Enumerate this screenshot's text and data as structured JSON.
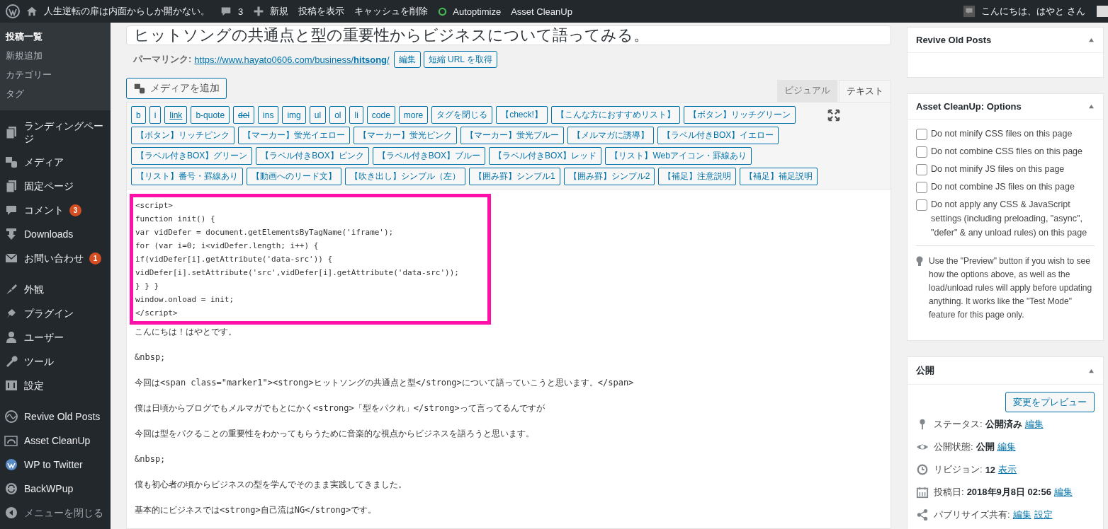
{
  "admin_bar": {
    "site_name": "人生逆転の扉は内面からしか開かない。",
    "comments": "3",
    "items": [
      "新規",
      "投稿を表示",
      "キャッシュを削除",
      "Autoptimize",
      "Asset CleanUp"
    ],
    "greeting": "こんにちは、はやと さん"
  },
  "sidebar": {
    "submenu": [
      {
        "label": "投稿一覧",
        "selected": true
      },
      {
        "label": "新規追加",
        "selected": false
      },
      {
        "label": "カテゴリー",
        "selected": false
      },
      {
        "label": "タグ",
        "selected": false
      }
    ],
    "menu": [
      {
        "label": "ランディングページ"
      },
      {
        "label": "メディア"
      },
      {
        "label": "固定ページ"
      },
      {
        "label": "コメント",
        "badge": "3"
      },
      {
        "label": "Downloads"
      },
      {
        "label": "お問い合わせ",
        "badge": "1"
      },
      {
        "label": "外観"
      },
      {
        "label": "プラグイン"
      },
      {
        "label": "ユーザー"
      },
      {
        "label": "ツール"
      },
      {
        "label": "設定"
      },
      {
        "label": "Revive Old Posts"
      },
      {
        "label": "Asset CleanUp"
      },
      {
        "label": "WP to Twitter"
      },
      {
        "label": "BackWPup"
      },
      {
        "label": "メニューを閉じる"
      }
    ]
  },
  "editor": {
    "title": "ヒットソングの共通点と型の重要性からビジネスについて語ってみる。",
    "permalink_label": "パーマリンク:",
    "permalink_base": "https://www.hayato0606.com/business/",
    "permalink_slug": "hitsong",
    "permalink_suffix": "/",
    "permalink_buttons": [
      "編集",
      "短縮 URL を取得"
    ],
    "media_button": "メディアを追加",
    "tabs": [
      {
        "label": "ビジュアル",
        "selected": false
      },
      {
        "label": "テキスト",
        "selected": true
      }
    ],
    "toolbar_rows": [
      [
        {
          "label": "b",
          "kind": "plain"
        },
        {
          "label": "i",
          "kind": "plain"
        },
        {
          "label": "link",
          "kind": "link"
        },
        {
          "label": "b-quote",
          "kind": "plain"
        },
        {
          "label": "del",
          "kind": "del"
        },
        {
          "label": "ins",
          "kind": "plain"
        },
        {
          "label": "img",
          "kind": "plain"
        },
        {
          "label": "ul",
          "kind": "plain"
        },
        {
          "label": "ol",
          "kind": "plain"
        },
        {
          "label": "li",
          "kind": "plain"
        },
        {
          "label": "code",
          "kind": "plain"
        },
        {
          "label": "more",
          "kind": "plain"
        },
        {
          "label": "タグを閉じる",
          "kind": "plain"
        },
        {
          "label": "【check!】",
          "kind": "plain"
        },
        {
          "label": "【こんな方におすすめリスト】",
          "kind": "plain"
        },
        {
          "label": "【ボタン】リッチグリーン",
          "kind": "plain"
        }
      ],
      [
        {
          "label": "【ボタン】リッチピンク",
          "kind": "plain"
        },
        {
          "label": "【マーカー】蛍光イエロー",
          "kind": "plain"
        },
        {
          "label": "【マーカー】蛍光ピンク",
          "kind": "plain"
        },
        {
          "label": "【マーカー】蛍光ブルー",
          "kind": "plain"
        },
        {
          "label": "【メルマガに誘導】",
          "kind": "plain"
        },
        {
          "label": "【ラベル付きBOX】イエロー",
          "kind": "plain"
        }
      ],
      [
        {
          "label": "【ラベル付きBOX】グリーン",
          "kind": "plain"
        },
        {
          "label": "【ラベル付きBOX】ピンク",
          "kind": "plain"
        },
        {
          "label": "【ラベル付きBOX】ブルー",
          "kind": "plain"
        },
        {
          "label": "【ラベル付きBOX】レッド",
          "kind": "plain"
        },
        {
          "label": "【リスト】Webアイコン・罫線あり",
          "kind": "plain"
        }
      ],
      [
        {
          "label": "【リスト】番号・罫線あり",
          "kind": "plain"
        },
        {
          "label": "【動画へのリード文】",
          "kind": "plain"
        },
        {
          "label": "【吹き出し】シンプル（左）",
          "kind": "plain"
        },
        {
          "label": "【囲み罫】シンプル1",
          "kind": "plain"
        },
        {
          "label": "【囲み罫】シンプル2",
          "kind": "plain"
        },
        {
          "label": "【補足】注意説明",
          "kind": "plain"
        },
        {
          "label": "【補足】補足説明",
          "kind": "plain"
        }
      ]
    ],
    "code_lines": [
      "<script>",
      "function init() {",
      "var vidDefer = document.getElementsByTagName('iframe');",
      "for (var i=0; i<vidDefer.length; i++) {",
      "if(vidDefer[i].getAttribute('data-src')) {",
      "vidDefer[i].setAttribute('src',vidDefer[i].getAttribute('data-src'));",
      "} } }",
      "window.onload = init;",
      "</script>"
    ],
    "paragraphs": [
      "こんにちは！はやとです。",
      "&nbsp;",
      "今回は<span class=\"marker1\"><strong>ヒットソングの共通点と型</strong>について語っていこうと思います。</span>",
      "僕は日頃からブログでもメルマガでもとにかく<strong>「型をパクれ」</strong>って言ってるんですが",
      "今回は型をパクることの重要性をわかってもらうために音楽的な視点からビジネスを語ろうと思います。",
      "&nbsp;",
      "僕も初心者の頃からビジネスの型を学んでそのまま実践してきました。",
      "基本的にビジネスでは<strong>自己流はNG</strong>です。"
    ]
  },
  "revive_box": {
    "title": "Revive Old Posts"
  },
  "assets_box": {
    "title": "Asset CleanUp: Options",
    "options": [
      {
        "label": "Do not minify CSS files on this page",
        "checked": false
      },
      {
        "label": "Do not combine CSS files on this page",
        "checked": false
      },
      {
        "label": "Do not minify JS files on this page",
        "checked": false
      },
      {
        "label": "Do not combine JS files on this page",
        "checked": false
      },
      {
        "label": "Do not apply any CSS & JavaScript settings (including preloading, \"async\", \"defer\" & any unload rules) on this page",
        "checked": false
      }
    ],
    "note": "Use the \"Preview\" button if you wish to see how the options above, as well as the load/unload rules will apply before updating anything. It works like the \"Test Mode\" feature for this page only."
  },
  "publish_box": {
    "title": "公開",
    "preview_button": "変更をプレビュー",
    "rows": [
      {
        "label": "ステータス:",
        "value": "公開済み",
        "links": [
          "編集"
        ]
      },
      {
        "label": "公開状態:",
        "value": "公開",
        "links": [
          "編集"
        ]
      },
      {
        "label": "リビジョン:",
        "value": "12",
        "links": [
          "表示"
        ]
      },
      {
        "label": "投稿日:",
        "value": "2018年9月8日 02:56",
        "links": [
          "編集"
        ]
      },
      {
        "label": "パブリサイズ共有:",
        "links": [
          "編集",
          "設定"
        ]
      }
    ]
  }
}
